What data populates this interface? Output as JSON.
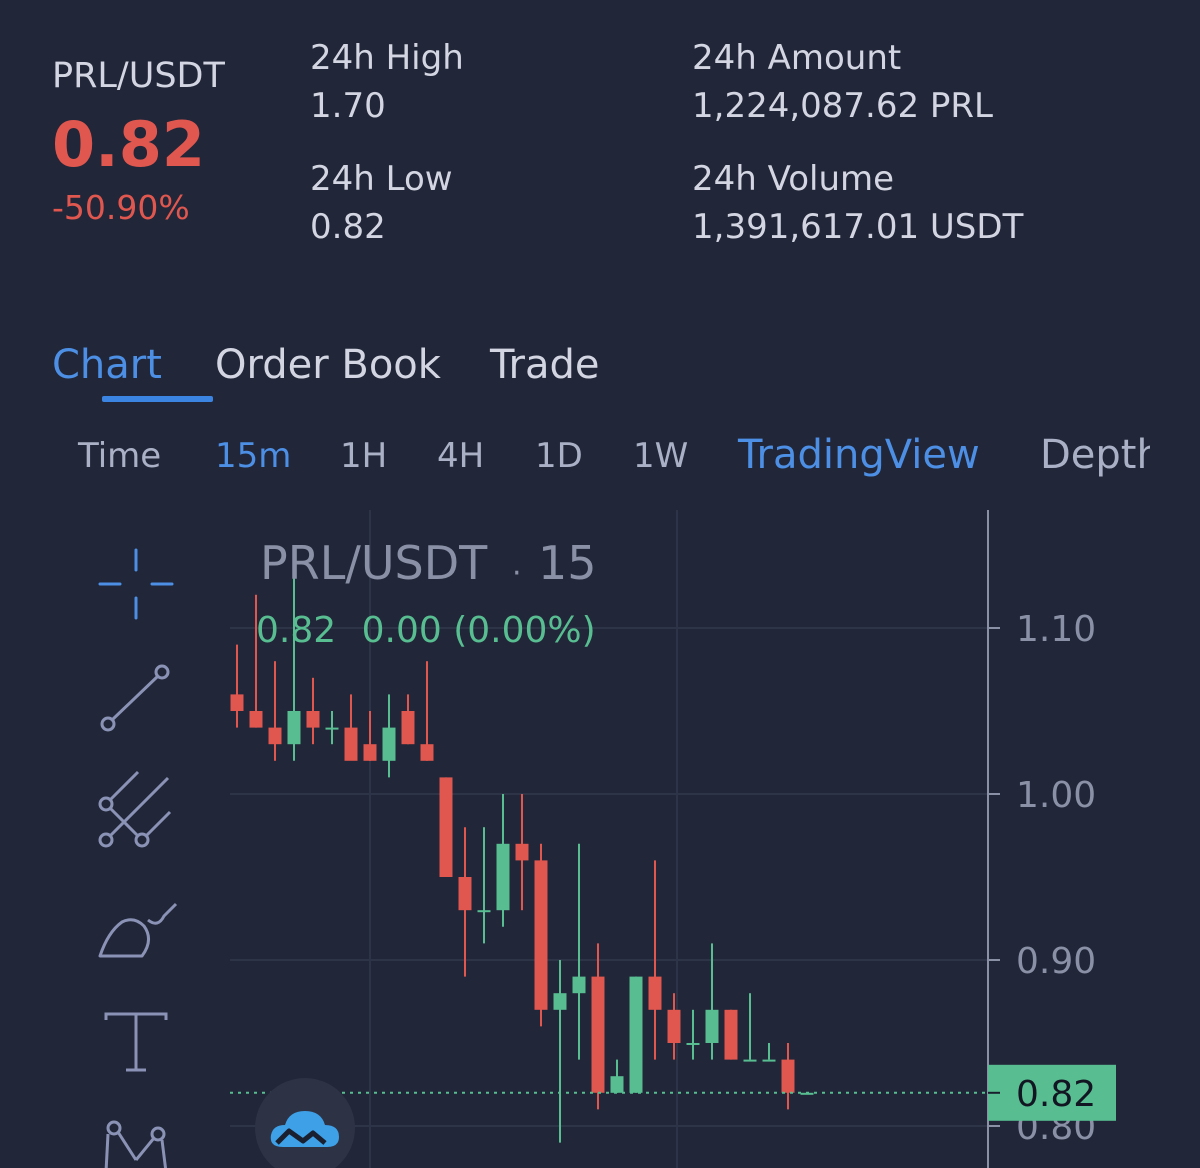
{
  "ticker": {
    "pair": "PRL/USDT",
    "last_price": "0.82",
    "change_pct": "-50.90%",
    "high_label": "24h High",
    "high_value": "1.70",
    "low_label": "24h Low",
    "low_value": "0.82",
    "amount_label": "24h Amount",
    "amount_value": "1,224,087.62 PRL",
    "volume_label": "24h Volume",
    "volume_value": "1,391,617.01 USDT"
  },
  "tabs": [
    {
      "label": "Chart",
      "active": true
    },
    {
      "label": "Order Book",
      "active": false
    },
    {
      "label": "Trade",
      "active": false
    }
  ],
  "intervals": [
    "Time",
    "15m",
    "1H",
    "4H",
    "1D",
    "1W"
  ],
  "active_interval": "15m",
  "views": [
    {
      "label": "TradingView",
      "active": true
    },
    {
      "label": "Depth",
      "active": false
    }
  ],
  "tools": [
    "crosshair-icon",
    "trend-line-icon",
    "pitchfork-icon",
    "brush-icon",
    "text-icon",
    "pattern-icon"
  ],
  "colors": {
    "background": "#212638",
    "up": "#58be91",
    "down": "#e0574f",
    "accent": "#4c8fe4"
  },
  "legend": {
    "symbol": "PRL/USDT",
    "interval": "15",
    "close": "0.82",
    "change": "0.00 (0.00%)"
  },
  "chart_data": {
    "type": "candlestick",
    "symbol": "PRL/USDT",
    "interval": "15",
    "y_ticks": [
      1.1,
      1.0,
      0.9,
      0.8
    ],
    "y_tick_labels": [
      "1.10",
      "1.00",
      "0.90",
      "0.80"
    ],
    "ylim": [
      0.78,
      1.18
    ],
    "last_price": 0.82,
    "last_price_label": "0.82",
    "candles": [
      {
        "o": 1.06,
        "h": 1.09,
        "l": 1.04,
        "c": 1.05
      },
      {
        "o": 1.05,
        "h": 1.12,
        "l": 1.04,
        "c": 1.04
      },
      {
        "o": 1.04,
        "h": 1.08,
        "l": 1.02,
        "c": 1.03
      },
      {
        "o": 1.03,
        "h": 1.14,
        "l": 1.02,
        "c": 1.05
      },
      {
        "o": 1.05,
        "h": 1.07,
        "l": 1.03,
        "c": 1.04
      },
      {
        "o": 1.04,
        "h": 1.05,
        "l": 1.03,
        "c": 1.04
      },
      {
        "o": 1.04,
        "h": 1.06,
        "l": 1.03,
        "c": 1.02
      },
      {
        "o": 1.03,
        "h": 1.05,
        "l": 1.02,
        "c": 1.02
      },
      {
        "o": 1.02,
        "h": 1.06,
        "l": 1.01,
        "c": 1.04
      },
      {
        "o": 1.05,
        "h": 1.06,
        "l": 1.03,
        "c": 1.03
      },
      {
        "o": 1.03,
        "h": 1.08,
        "l": 1.02,
        "c": 1.02
      },
      {
        "o": 1.01,
        "h": 1.01,
        "l": 0.95,
        "c": 0.95
      },
      {
        "o": 0.95,
        "h": 0.98,
        "l": 0.89,
        "c": 0.93
      },
      {
        "o": 0.93,
        "h": 0.98,
        "l": 0.91,
        "c": 0.93
      },
      {
        "o": 0.93,
        "h": 1.0,
        "l": 0.92,
        "c": 0.97
      },
      {
        "o": 0.97,
        "h": 1.0,
        "l": 0.93,
        "c": 0.96
      },
      {
        "o": 0.96,
        "h": 0.97,
        "l": 0.86,
        "c": 0.87
      },
      {
        "o": 0.87,
        "h": 0.9,
        "l": 0.79,
        "c": 0.88
      },
      {
        "o": 0.88,
        "h": 0.97,
        "l": 0.84,
        "c": 0.89
      },
      {
        "o": 0.89,
        "h": 0.91,
        "l": 0.81,
        "c": 0.82
      },
      {
        "o": 0.82,
        "h": 0.84,
        "l": 0.82,
        "c": 0.83
      },
      {
        "o": 0.82,
        "h": 0.89,
        "l": 0.82,
        "c": 0.89
      },
      {
        "o": 0.89,
        "h": 0.96,
        "l": 0.84,
        "c": 0.87
      },
      {
        "o": 0.87,
        "h": 0.88,
        "l": 0.84,
        "c": 0.85
      },
      {
        "o": 0.85,
        "h": 0.87,
        "l": 0.84,
        "c": 0.85
      },
      {
        "o": 0.85,
        "h": 0.91,
        "l": 0.84,
        "c": 0.87
      },
      {
        "o": 0.87,
        "h": 0.87,
        "l": 0.84,
        "c": 0.84
      },
      {
        "o": 0.84,
        "h": 0.88,
        "l": 0.84,
        "c": 0.84
      },
      {
        "o": 0.84,
        "h": 0.85,
        "l": 0.84,
        "c": 0.84
      },
      {
        "o": 0.84,
        "h": 0.85,
        "l": 0.81,
        "c": 0.82
      },
      {
        "o": 0.82,
        "h": 0.82,
        "l": 0.82,
        "c": 0.82
      }
    ]
  }
}
